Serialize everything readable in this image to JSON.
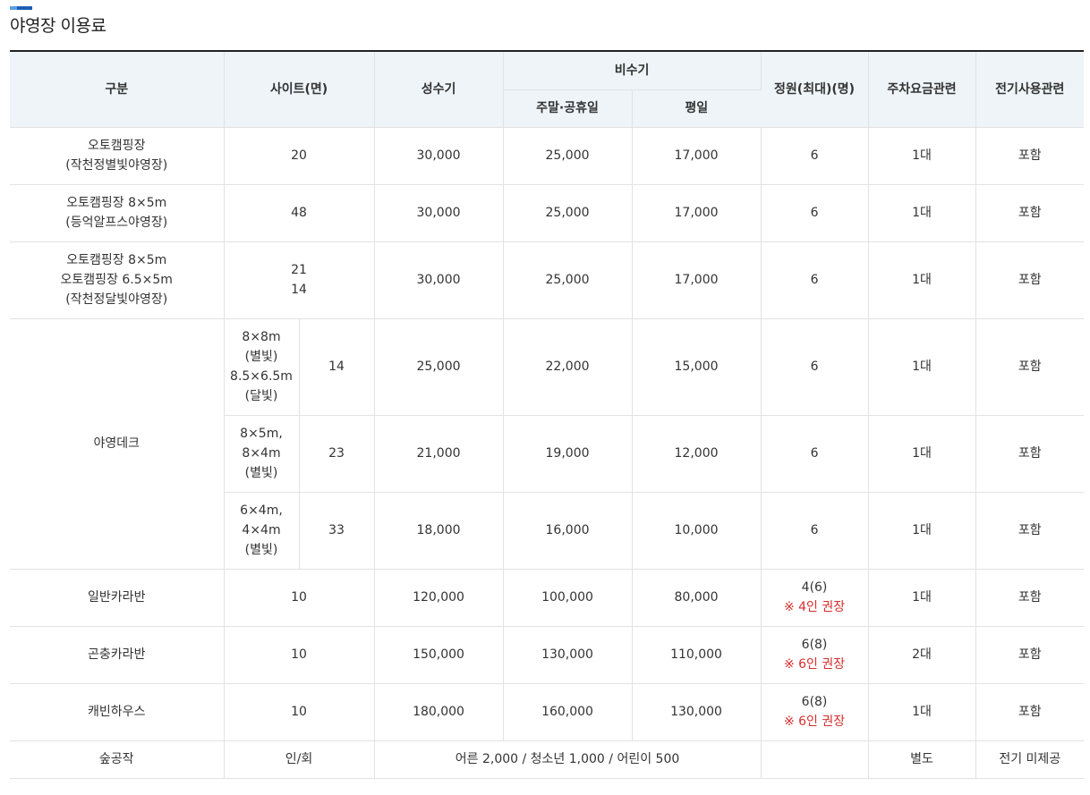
{
  "page": {
    "title": "야영장 이용료"
  },
  "table": {
    "headers": {
      "category": "구분",
      "site": "사이트(면)",
      "peak": "성수기",
      "off_peak": "비수기",
      "weekend": "주말·공휴일",
      "weekday": "평일",
      "capacity": "정원(최대)(명)",
      "parking": "주차요금관련",
      "electric": "전기사용관련"
    },
    "rows": [
      {
        "category": [
          "오토캠핑장",
          "(작천정별빛야영장)"
        ],
        "sites": [
          "20"
        ],
        "peak": "30,000",
        "weekend": "25,000",
        "weekday": "17,000",
        "capacity": "6",
        "parking": "1대",
        "electric": "포함"
      },
      {
        "category": [
          "오토캠핑장 8×5m",
          "(등억알프스야영장)"
        ],
        "sites": [
          "48"
        ],
        "peak": "30,000",
        "weekend": "25,000",
        "weekday": "17,000",
        "capacity": "6",
        "parking": "1대",
        "electric": "포함"
      },
      {
        "category": [
          "오토캠핑장 8×5m",
          "오토캠핑장 6.5×5m",
          "(작천정달빛야영장)"
        ],
        "sites": [
          "21",
          "14"
        ],
        "peak": "30,000",
        "weekend": "25,000",
        "weekday": "17,000",
        "capacity": "6",
        "parking": "1대",
        "electric": "포함"
      }
    ],
    "deck": {
      "category": "야영데크",
      "rows": [
        {
          "size": [
            "8×8m",
            "(별빛)",
            "8.5×6.5m",
            "(달빛)"
          ],
          "count": "14",
          "peak": "25,000",
          "weekend": "22,000",
          "weekday": "15,000",
          "capacity": "6",
          "parking": "1대",
          "electric": "포함"
        },
        {
          "size": [
            "8×5m,",
            "8×4m",
            "(별빛)"
          ],
          "count": "23",
          "peak": "21,000",
          "weekend": "19,000",
          "weekday": "12,000",
          "capacity": "6",
          "parking": "1대",
          "electric": "포함"
        },
        {
          "size": [
            "6×4m,",
            "4×4m",
            "(별빛)"
          ],
          "count": "33",
          "peak": "18,000",
          "weekend": "16,000",
          "weekday": "10,000",
          "capacity": "6",
          "parking": "1대",
          "electric": "포함"
        }
      ]
    },
    "caravans": [
      {
        "category": "일반카라반",
        "sites": "10",
        "peak": "120,000",
        "weekend": "100,000",
        "weekday": "80,000",
        "capacity": "4(6)",
        "note": "※ 4인 권장",
        "parking": "1대",
        "electric": "포함"
      },
      {
        "category": "곤충카라반",
        "sites": "10",
        "peak": "150,000",
        "weekend": "130,000",
        "weekday": "110,000",
        "capacity": "6(8)",
        "note": "※ 6인 권장",
        "parking": "2대",
        "electric": "포함"
      },
      {
        "category": "캐빈하우스",
        "sites": "10",
        "peak": "180,000",
        "weekend": "160,000",
        "weekday": "130,000",
        "capacity": "6(8)",
        "note": "※ 6인 권장",
        "parking": "1대",
        "electric": "포함"
      }
    ],
    "forest": {
      "category": "숲공작",
      "sites": "인/회",
      "fee": "어른 2,000 / 청소년 1,000 / 어린이 500",
      "capacity": "",
      "parking": "별도",
      "electric": "전기 미제공"
    }
  },
  "colors": {
    "header_bg": "#eef4f8",
    "accent_blue": "#1e5fb4",
    "note_red": "#d62e2e"
  }
}
